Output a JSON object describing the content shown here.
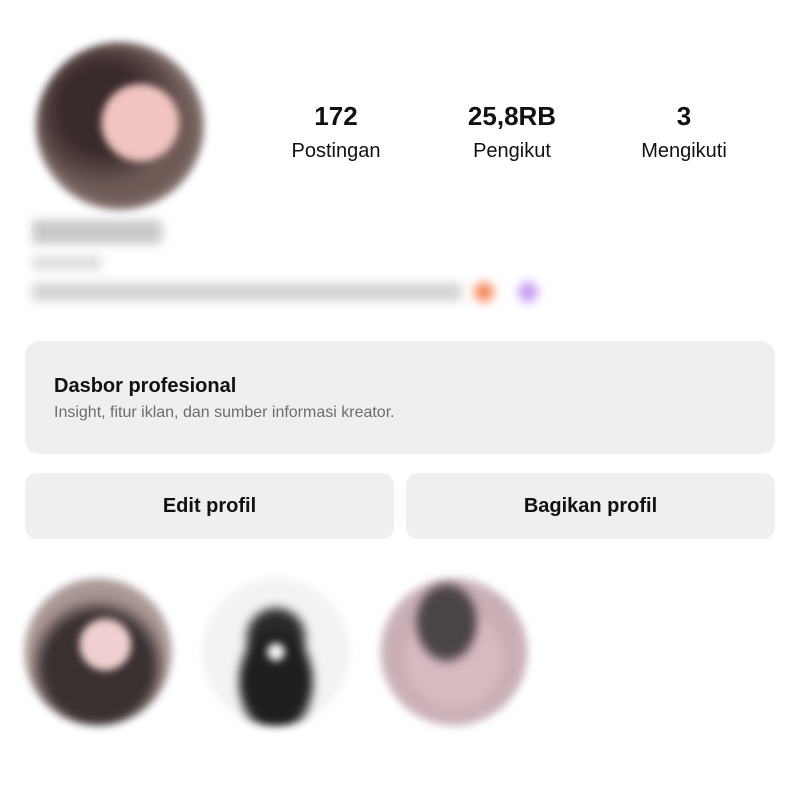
{
  "profile": {
    "stats": [
      {
        "value": "172",
        "label": "Postingan"
      },
      {
        "value": "25,8RB",
        "label": "Pengikut"
      },
      {
        "value": "3",
        "label": "Mengikuti"
      }
    ]
  },
  "dashboard": {
    "title": "Dasbor profesional",
    "subtitle": "Insight, fitur iklan, dan sumber informasi kreator."
  },
  "buttons": {
    "edit_label": "Edit profil",
    "share_label": "Bagikan profil"
  },
  "colors": {
    "background": "#ffffff",
    "card": "#efefef",
    "text": "#111111",
    "muted": "#6c6c6c"
  }
}
